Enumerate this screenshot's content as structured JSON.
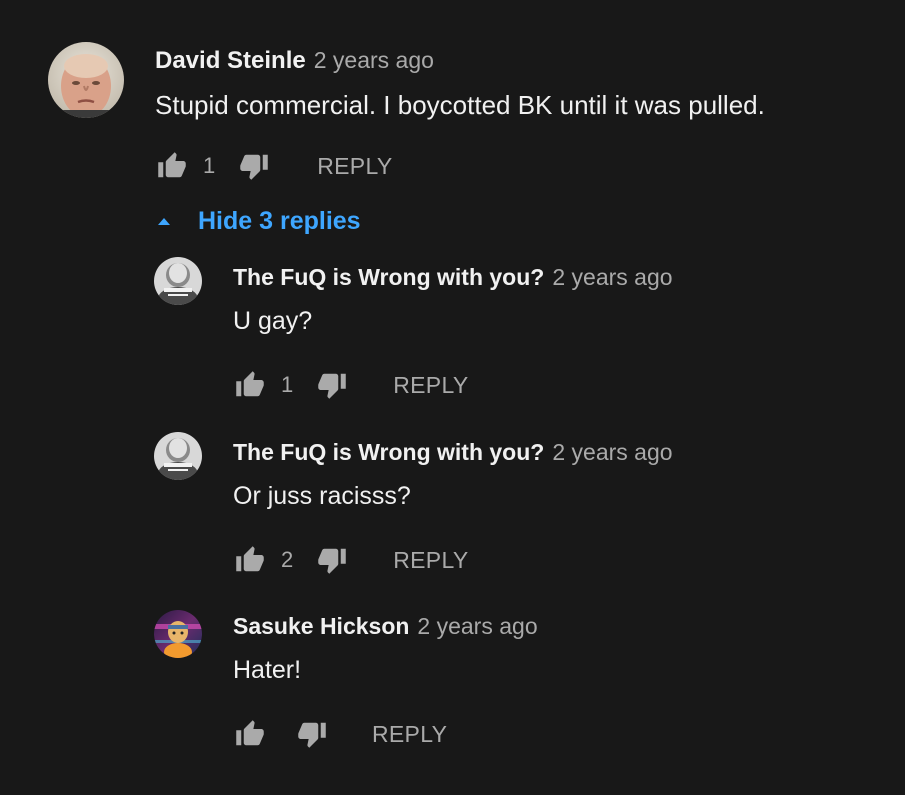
{
  "comment": {
    "author": "David Steinle",
    "time": "2 years ago",
    "text": "Stupid commercial. I boycotted BK until it was pulled.",
    "likes": "1",
    "reply_label": "REPLY"
  },
  "toggle": {
    "label": "Hide 3 replies",
    "icon": "caret-up-icon",
    "color": "#3ea6ff"
  },
  "replies": [
    {
      "author": "The FuQ is Wrong with you?",
      "time": "2 years ago",
      "text": "U gay?",
      "likes": "1",
      "reply_label": "REPLY"
    },
    {
      "author": "The FuQ is Wrong with you?",
      "time": "2 years ago",
      "text": "Or juss racisss?",
      "likes": "2",
      "reply_label": "REPLY"
    },
    {
      "author": "Sasuke Hickson",
      "time": "2 years ago",
      "text": "Hater!",
      "likes": "",
      "reply_label": "REPLY"
    }
  ],
  "colors": {
    "background": "#181818",
    "text": "#f1f1f1",
    "secondary": "#aaaaaa",
    "link": "#3ea6ff"
  }
}
